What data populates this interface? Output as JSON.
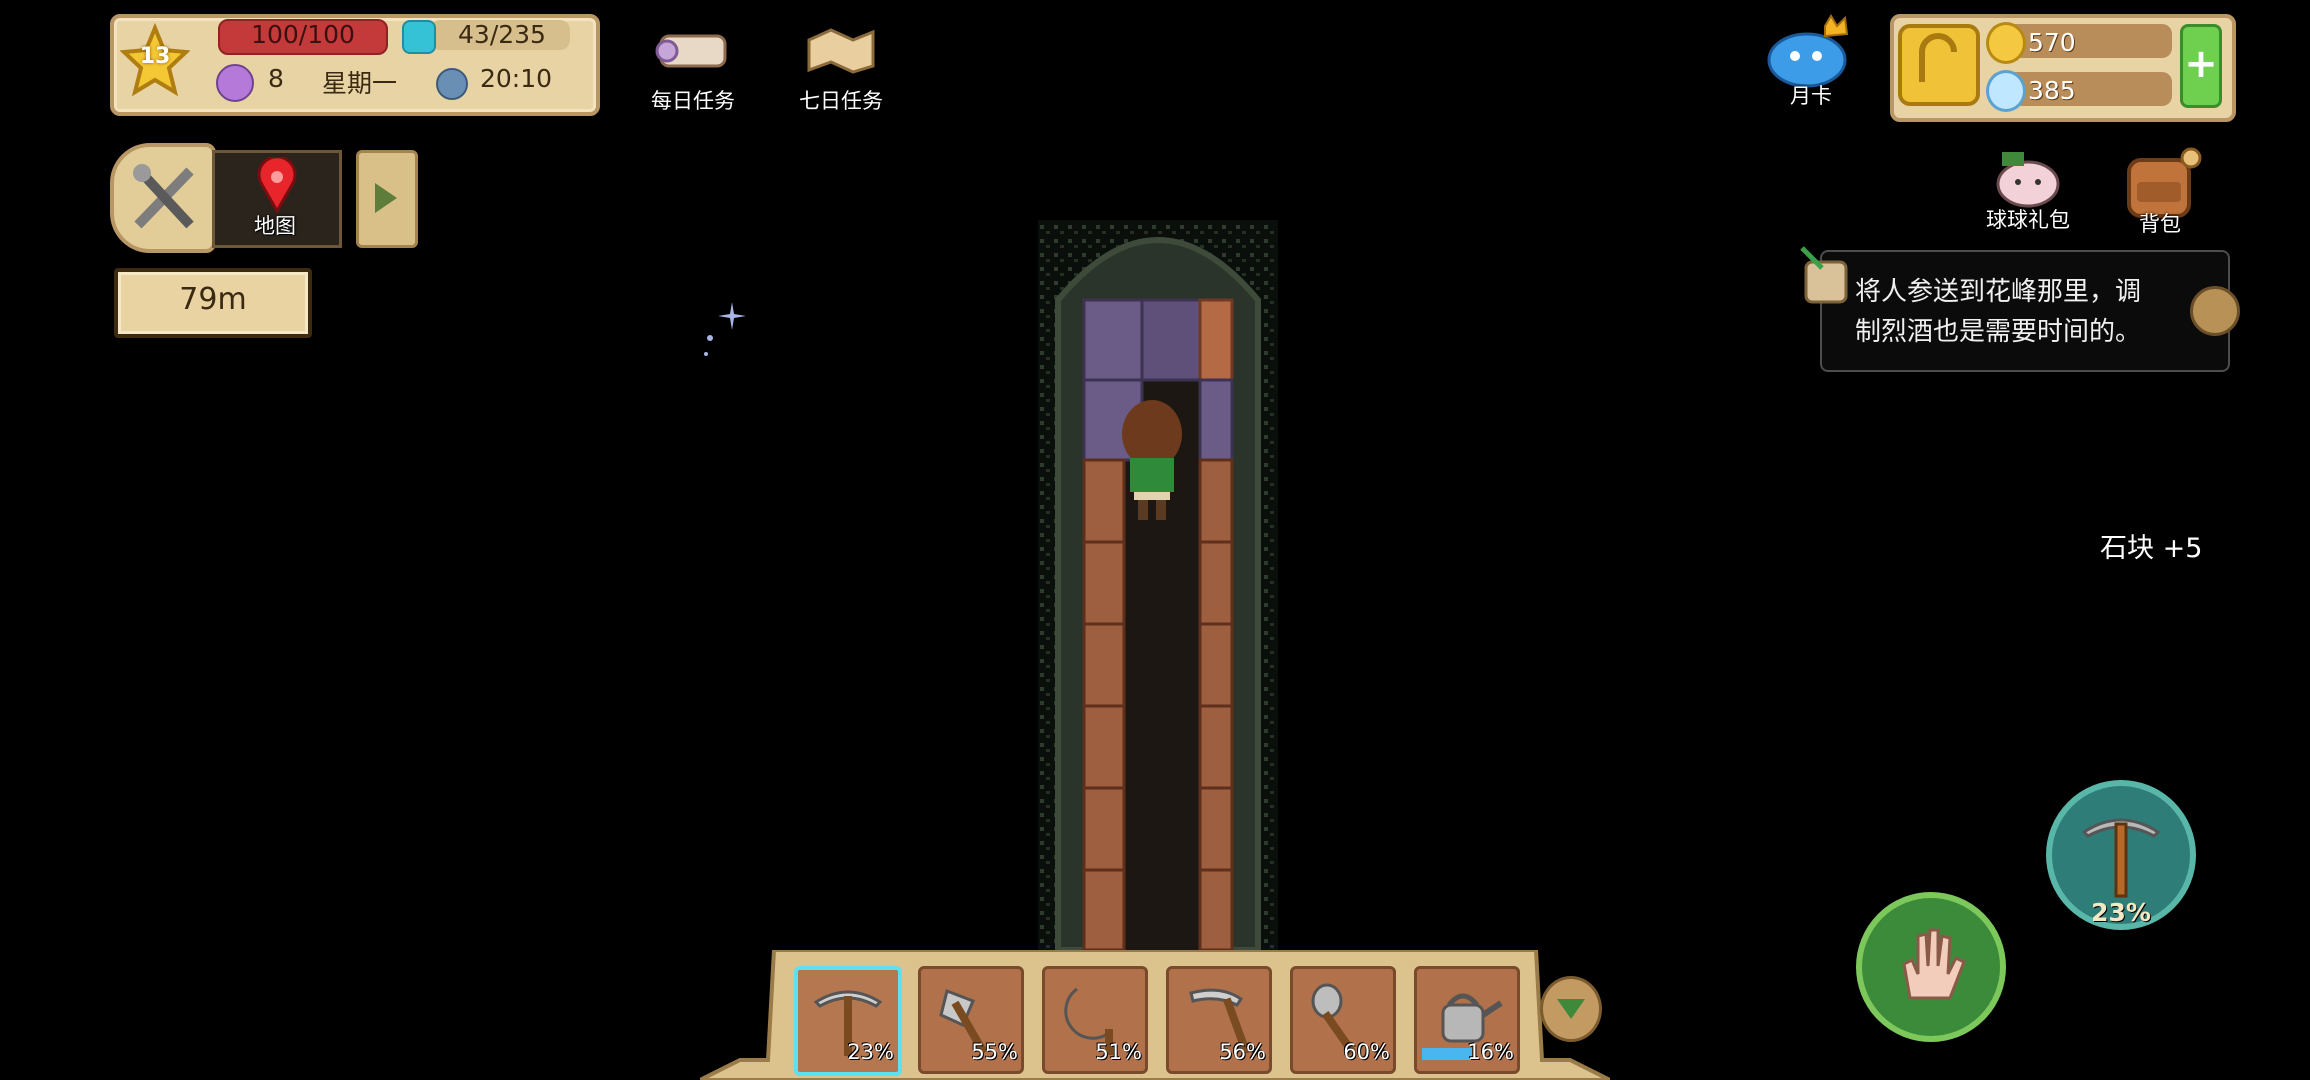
{
  "status": {
    "level": "13",
    "hp": "100/100",
    "energy": "43/235",
    "day": "8",
    "weekday": "星期一",
    "time": "20:10"
  },
  "tasks": {
    "daily": "每日任务",
    "seven_day": "七日任务"
  },
  "nav": {
    "map_label": "地图",
    "depth": "79m"
  },
  "top_right": {
    "monthly_card": "月卡",
    "gold": "570",
    "gems": "385",
    "gift_pack": "球球礼包",
    "backpack": "背包"
  },
  "notice": {
    "line1": "将人参送到花峰那里，调",
    "line2": "制烈酒也是需要时间的。"
  },
  "pickup": "石块 +5",
  "action": {
    "pickaxe_durability": "23%"
  },
  "hotbar": [
    {
      "tool": "pickaxe-icon",
      "pct": "23%"
    },
    {
      "tool": "axe-icon",
      "pct": "55%"
    },
    {
      "tool": "sickle-icon",
      "pct": "51%"
    },
    {
      "tool": "scythe-icon",
      "pct": "56%"
    },
    {
      "tool": "shovel-icon",
      "pct": "60%"
    },
    {
      "tool": "watering-can-icon",
      "pct": "16%"
    }
  ],
  "colors": {
    "hp": "#c43a3a",
    "energy": "#35c2d6",
    "panel": "#e7d3a4",
    "selected_slot": "#5de0f2"
  }
}
